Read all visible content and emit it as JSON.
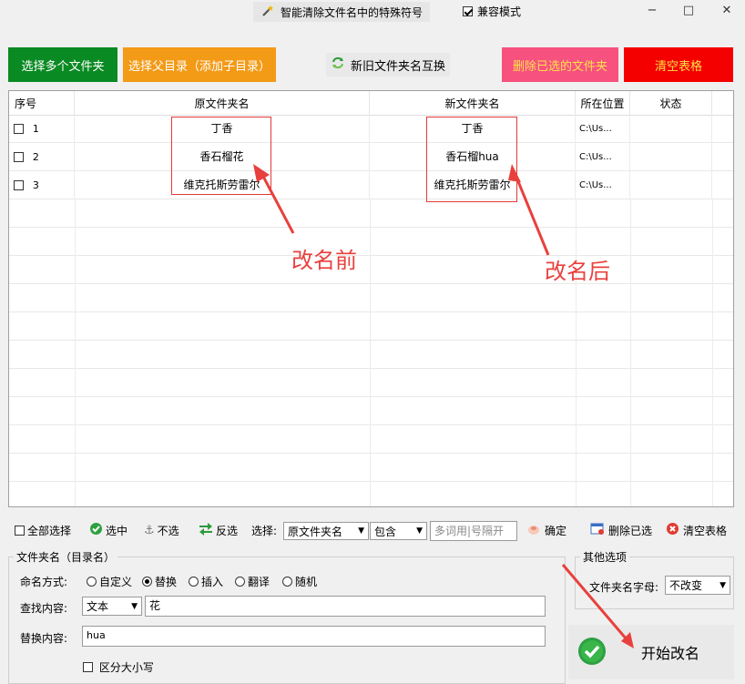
{
  "titlebar": {
    "title_button": "智能清除文件名中的特殊符号",
    "compat_label": "兼容模式",
    "minimize": "−",
    "maximize": "□",
    "close": "✕"
  },
  "toolbar": {
    "select_multi": "选择多个文件夹",
    "select_parent": "选择父目录（添加子目录）",
    "swap_names": "新旧文件夹名互换",
    "delete_selected": "删除已选的文件夹",
    "clear_table": "清空表格"
  },
  "table": {
    "headers": [
      "序号",
      "原文件夹名",
      "新文件夹名",
      "所在位置",
      "状态"
    ],
    "rows": [
      {
        "index": "1",
        "original": "丁香",
        "new": "丁香",
        "location": "C:\\Us...",
        "status": ""
      },
      {
        "index": "2",
        "original": "香石榴花",
        "new": "香石榴hua",
        "location": "C:\\Us...",
        "status": ""
      },
      {
        "index": "3",
        "original": "维克托斯劳雷尔",
        "new": "维克托斯劳雷尔",
        "location": "C:\\Us...",
        "status": ""
      }
    ]
  },
  "annotations": {
    "before": "改名前",
    "after": "改名后"
  },
  "selection_bar": {
    "select_all": "全部选择",
    "check": "选中",
    "uncheck": "不选",
    "invert": "反选",
    "select_label": "选择:",
    "field_value": "原文件夹名",
    "match_value": "包含",
    "keyword_placeholder": "多词用|号隔开",
    "confirm": "确定",
    "delete_selected": "删除已选",
    "clear_table": "清空表格"
  },
  "rename_group": {
    "title": "文件夹名（目录名）",
    "mode_label": "命名方式:",
    "modes": [
      "自定义",
      "替换",
      "插入",
      "翻译",
      "随机"
    ],
    "selected_mode": 1,
    "find_label": "查找内容:",
    "find_type": "文本",
    "find_value": "花",
    "replace_label": "替换内容:",
    "replace_value": "hua",
    "case_sensitive": "区分大小写"
  },
  "other_options": {
    "title": "其他选项",
    "letters_label": "文件夹名字母:",
    "letters_value": "不改变"
  },
  "start_button": "开始改名",
  "colors": {
    "green": "#0a8a23",
    "orange": "#f39a16",
    "pink": "#f7517f",
    "red": "#f40000",
    "annotation_red": "#e8413d"
  }
}
